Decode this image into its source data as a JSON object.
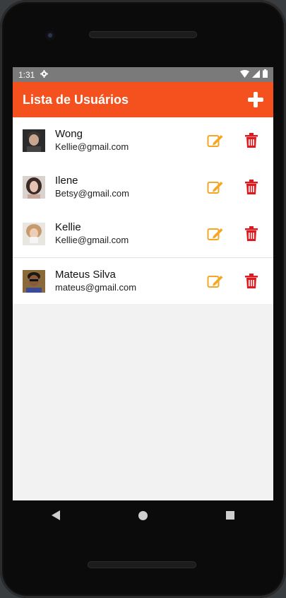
{
  "status_bar": {
    "time": "1:31"
  },
  "app_bar": {
    "title": "Lista de Usuários",
    "add_icon": "plus-icon"
  },
  "users": [
    {
      "name": "Wong",
      "email": "Kellie@gmail.com"
    },
    {
      "name": "Ilene",
      "email": "Betsy@gmail.com"
    },
    {
      "name": "Kellie",
      "email": "Kellie@gmail.com"
    },
    {
      "name": "Mateus Silva",
      "email": "mateus@gmail.com"
    }
  ],
  "colors": {
    "accent": "#f4511e",
    "edit": "#f5a623",
    "delete": "#e0191f",
    "status_bar": "#7a7a7a"
  },
  "nav": {
    "back_icon": "back-icon",
    "home_icon": "home-icon",
    "recents_icon": "recents-icon"
  }
}
